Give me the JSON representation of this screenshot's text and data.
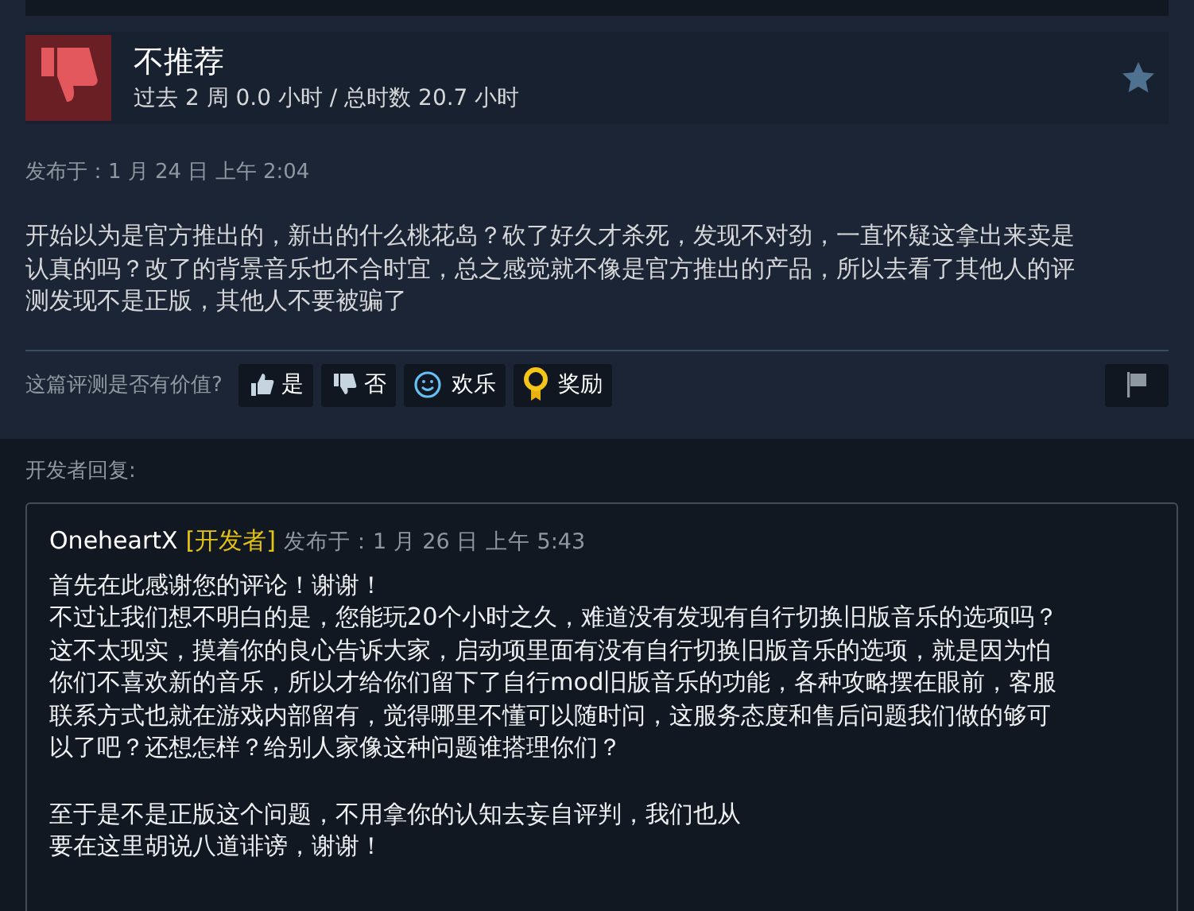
{
  "review": {
    "verdict": "不推荐",
    "recommended": false,
    "hours": "过去 2 周 0.0 小时 / 总时数 20.7 小时",
    "posted": "发布于：1 月 24 日 上午 2:04",
    "body": [
      "开始以为是官方推出的，新出的什么桃花岛？砍了好久才杀死，发现不对劲，一直怀疑这拿出来卖是",
      "认真的吗？改了的背景音乐也不合时宜，总之感觉就不像是官方推出的产品，所以去看了其他人的评",
      "测发现不是正版，其他人不要被骗了"
    ]
  },
  "helpful": {
    "question": "这篇评测是否有价值?",
    "buttons": [
      {
        "kind": "yes",
        "label": "是"
      },
      {
        "kind": "no",
        "label": "否"
      },
      {
        "kind": "funny",
        "label": "欢乐"
      },
      {
        "kind": "award",
        "label": "奖励"
      }
    ]
  },
  "developer_reply": {
    "heading": "开发者回复:",
    "author": "OneheartX",
    "badge": "[开发者]",
    "posted": "发布于：1 月 26 日 上午 5:43",
    "paragraphs": [
      [
        "首先在此感谢您的评论！谢谢！",
        "不过让我们想不明白的是，您能玩20个小时之久，难道没有发现有自行切换旧版音乐的选项吗？",
        "这不太现实，摸着你的良心告诉大家，启动项里面有没有自行切换旧版音乐的选项，就是因为怕",
        "你们不喜欢新的音乐，所以才给你们留下了自行mod旧版音乐的功能，各种攻略摆在眼前，客服",
        "联系方式也就在游戏内部留有，觉得哪里不懂可以随时问，这服务态度和售后问题我们做的够可",
        "以了吧？还想怎样？给别人家像这种问题谁搭理你们？"
      ],
      [
        "至于是不是正版这个问题，不用拿你的认知去妄自评判，我们也从",
        "要在这里胡说八道诽谤，谢谢！"
      ]
    ]
  }
}
